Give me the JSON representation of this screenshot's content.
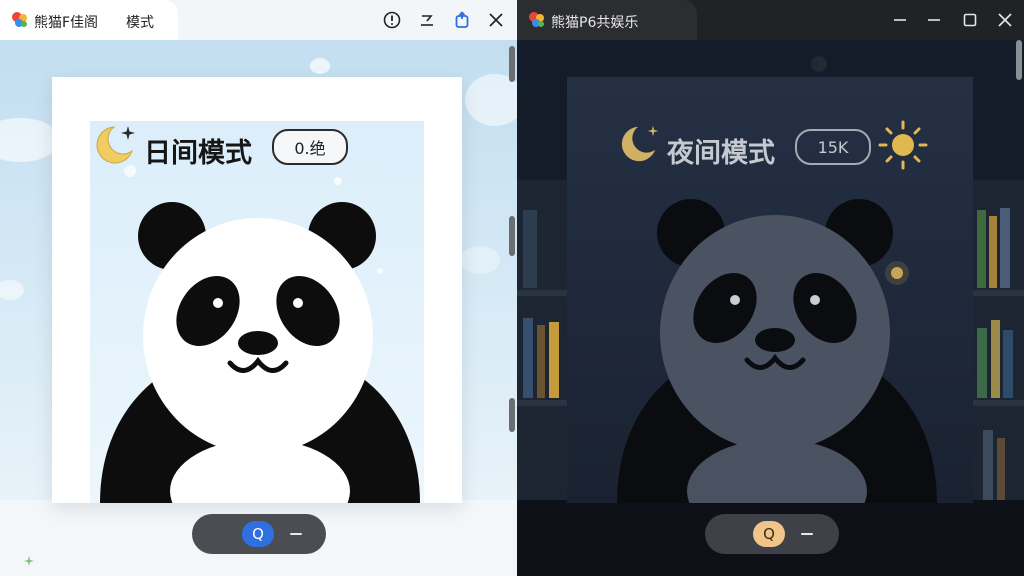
{
  "left_window": {
    "tab_title": "熊猫F佳阁",
    "tab_mode": "模式",
    "card": {
      "title": "日间模式",
      "pill_text": "0.绝"
    },
    "toggle_knob": "Q",
    "toggle_dash": "−",
    "colors": {
      "accent": "#2f6fe0",
      "pill_border": "#2b2b2b",
      "moon": "#f1cd5f"
    }
  },
  "right_window": {
    "tab_title": "熊猫P6共娱乐",
    "card": {
      "title": "夜间模式",
      "pill_text": "15K"
    },
    "toggle_knob": "Q",
    "toggle_dash": "−",
    "colors": {
      "knob": "#f1c58a",
      "moon": "#d0b062",
      "sun": "#e0b84f"
    }
  },
  "icons": [
    "app-logo-icon",
    "info-icon",
    "minimize-icon",
    "share-icon",
    "close-icon",
    "maximize-icon",
    "moon-icon",
    "sparkle-icon",
    "sun-icon"
  ]
}
